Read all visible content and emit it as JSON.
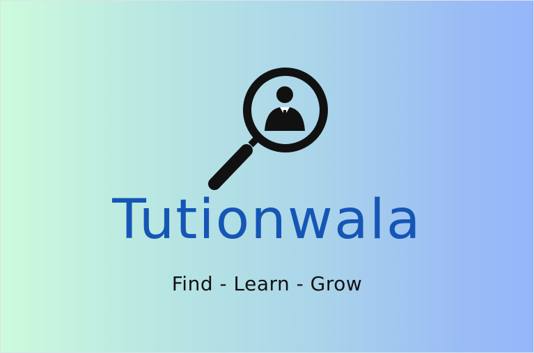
{
  "brand": {
    "name": "Tutionwala",
    "tagline": "Find - Learn - Grow",
    "logo_icon": "magnifier-person-icon"
  },
  "colors": {
    "brand_blue": "#1556b5",
    "text_dark": "#111111",
    "icon_black": "#111111",
    "gradient_start": "#cdfbdc",
    "gradient_end": "#95b6fb"
  }
}
